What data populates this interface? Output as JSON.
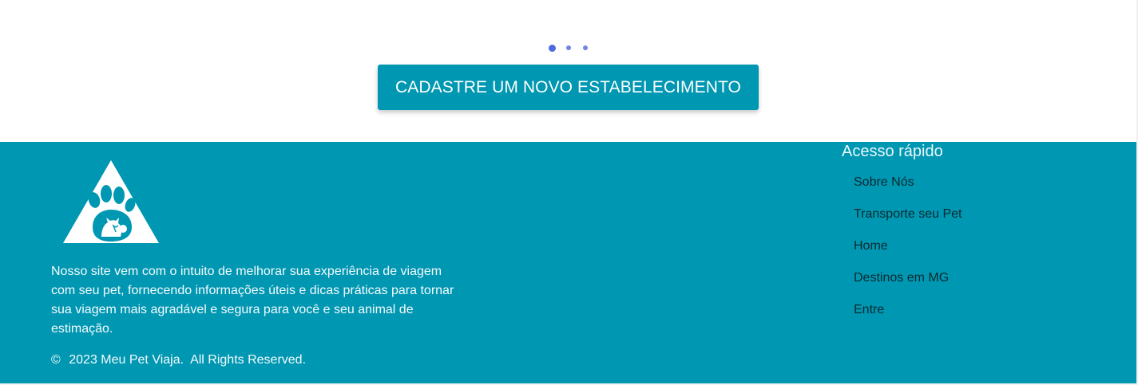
{
  "carousel": {
    "dots": [
      {
        "active": true,
        "color": "#4d6ae0"
      },
      {
        "active": false,
        "color": "#6f86e8"
      },
      {
        "active": false,
        "color": "#6f86e8"
      }
    ]
  },
  "cta": {
    "label": "CADASTRE UM NOVO ESTABELECIMENTO",
    "color": "#0097b2"
  },
  "footer": {
    "background": "#0097b2",
    "logo_icon": "paw-triangle-logo",
    "about": "Nosso site vem com o intuito de melhorar sua experiência de viagem com seu pet, fornecendo informações úteis e dicas práticas para tornar sua viagem mais agradável e segura para você e seu animal de estimação.",
    "copyright_symbol": "©",
    "copyright_text": "2023 Meu Pet Viaja.  All Rights Reserved.",
    "quick_access": {
      "title": "Acesso rápido",
      "links": [
        "Sobre Nós",
        "Transporte seu Pet",
        "Home",
        "Destinos em MG",
        "Entre"
      ]
    }
  }
}
